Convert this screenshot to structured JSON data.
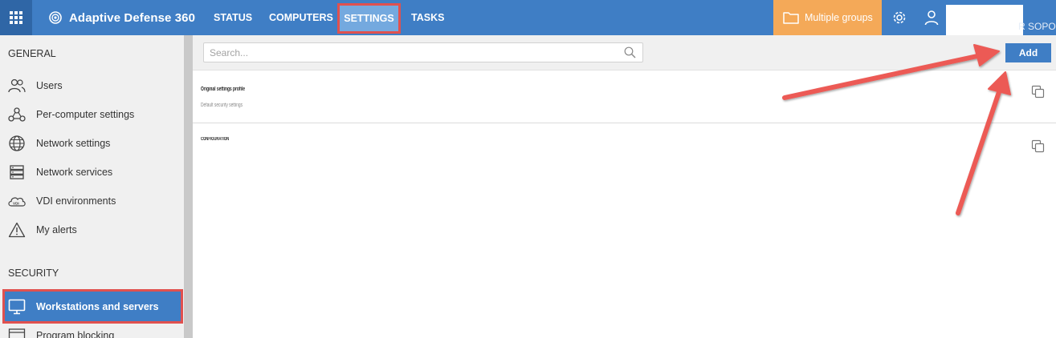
{
  "header": {
    "product_name": "Adaptive Defense 360",
    "nav": [
      {
        "label": "STATUS"
      },
      {
        "label": "COMPUTERS"
      },
      {
        "label": "SETTINGS"
      },
      {
        "label": "TASKS"
      }
    ],
    "groups_label": "Multiple groups",
    "user_name": "R SOPO"
  },
  "sidebar": {
    "general_title": "GENERAL",
    "general_items": [
      {
        "label": "Users",
        "icon": "users-icon"
      },
      {
        "label": "Per-computer settings",
        "icon": "network-nodes-icon"
      },
      {
        "label": "Network settings",
        "icon": "globe-icon"
      },
      {
        "label": "Network services",
        "icon": "server-icon"
      },
      {
        "label": "VDI environments",
        "icon": "vdi-cloud-icon"
      },
      {
        "label": "My alerts",
        "icon": "warning-icon"
      }
    ],
    "security_title": "SECURITY",
    "security_items": [
      {
        "label": "Workstations and servers",
        "icon": "monitor-icon"
      },
      {
        "label": "Program blocking",
        "icon": "window-icon"
      }
    ]
  },
  "toolbar": {
    "search_placeholder": "Search...",
    "add_label": "Add"
  },
  "settings_list": [
    {
      "title": "Original settings profile",
      "description": "Default security settings"
    },
    {
      "title": "CONFIGURATION",
      "description": ""
    }
  ],
  "colors": {
    "header_blue": "#3f7ec5",
    "groups_orange": "#f4a958",
    "highlight_red": "#e0514f",
    "sidebar_bg": "#f0f0f0"
  }
}
